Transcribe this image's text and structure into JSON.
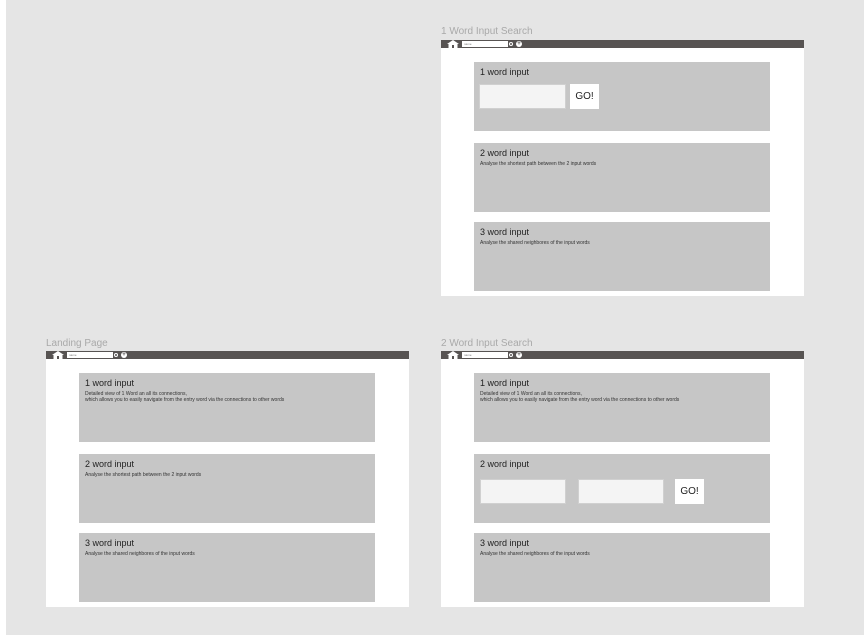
{
  "frames": {
    "one_word": {
      "label": "1 Word Input Search",
      "tab_title": "name",
      "new_tab_symbol": "+",
      "sections": [
        {
          "title": "1 word input",
          "go_label": "GO!",
          "input_value": ""
        },
        {
          "title": "2 word input",
          "desc": "Analyse the shortest path between the 2 input words"
        },
        {
          "title": "3 word input",
          "desc": "Analyse the shared neighbores of the input words"
        }
      ]
    },
    "landing": {
      "label": "Landing Page",
      "tab_title": "name",
      "new_tab_symbol": "+",
      "sections": [
        {
          "title": "1 word input",
          "desc_lines": [
            "Detailed view of 1 Word an all its connections,",
            "which allows you to easily navigate from the entry word via the connections to other words"
          ]
        },
        {
          "title": "2 word input",
          "desc": "Analyse the shortest path between the 2 input words"
        },
        {
          "title": "3 word input",
          "desc": "Analyse the shared neighbores of the input words"
        }
      ]
    },
    "two_word": {
      "label": "2 Word Input Search",
      "tab_title": "name",
      "new_tab_symbol": "+",
      "sections": [
        {
          "title": "1 word input",
          "desc_lines": [
            "Detailed view of 1 Word an all its connections,",
            "which allows you to easily navigate from the entry word via the connections to other words"
          ]
        },
        {
          "title": "2 word input",
          "go_label": "GO!",
          "input1_value": "",
          "input2_value": ""
        },
        {
          "title": "3 word input",
          "desc": "Analyse the shared neighbores of the input words"
        }
      ]
    }
  },
  "icons": {
    "home": "home-icon",
    "close": "close-tab-icon",
    "add": "new-tab-icon"
  },
  "colors": {
    "canvas": "#e5e5e5",
    "tabbar": "#575352",
    "section": "#c6c6c6",
    "frame": "#ffffff",
    "label": "#a9a9a9"
  }
}
